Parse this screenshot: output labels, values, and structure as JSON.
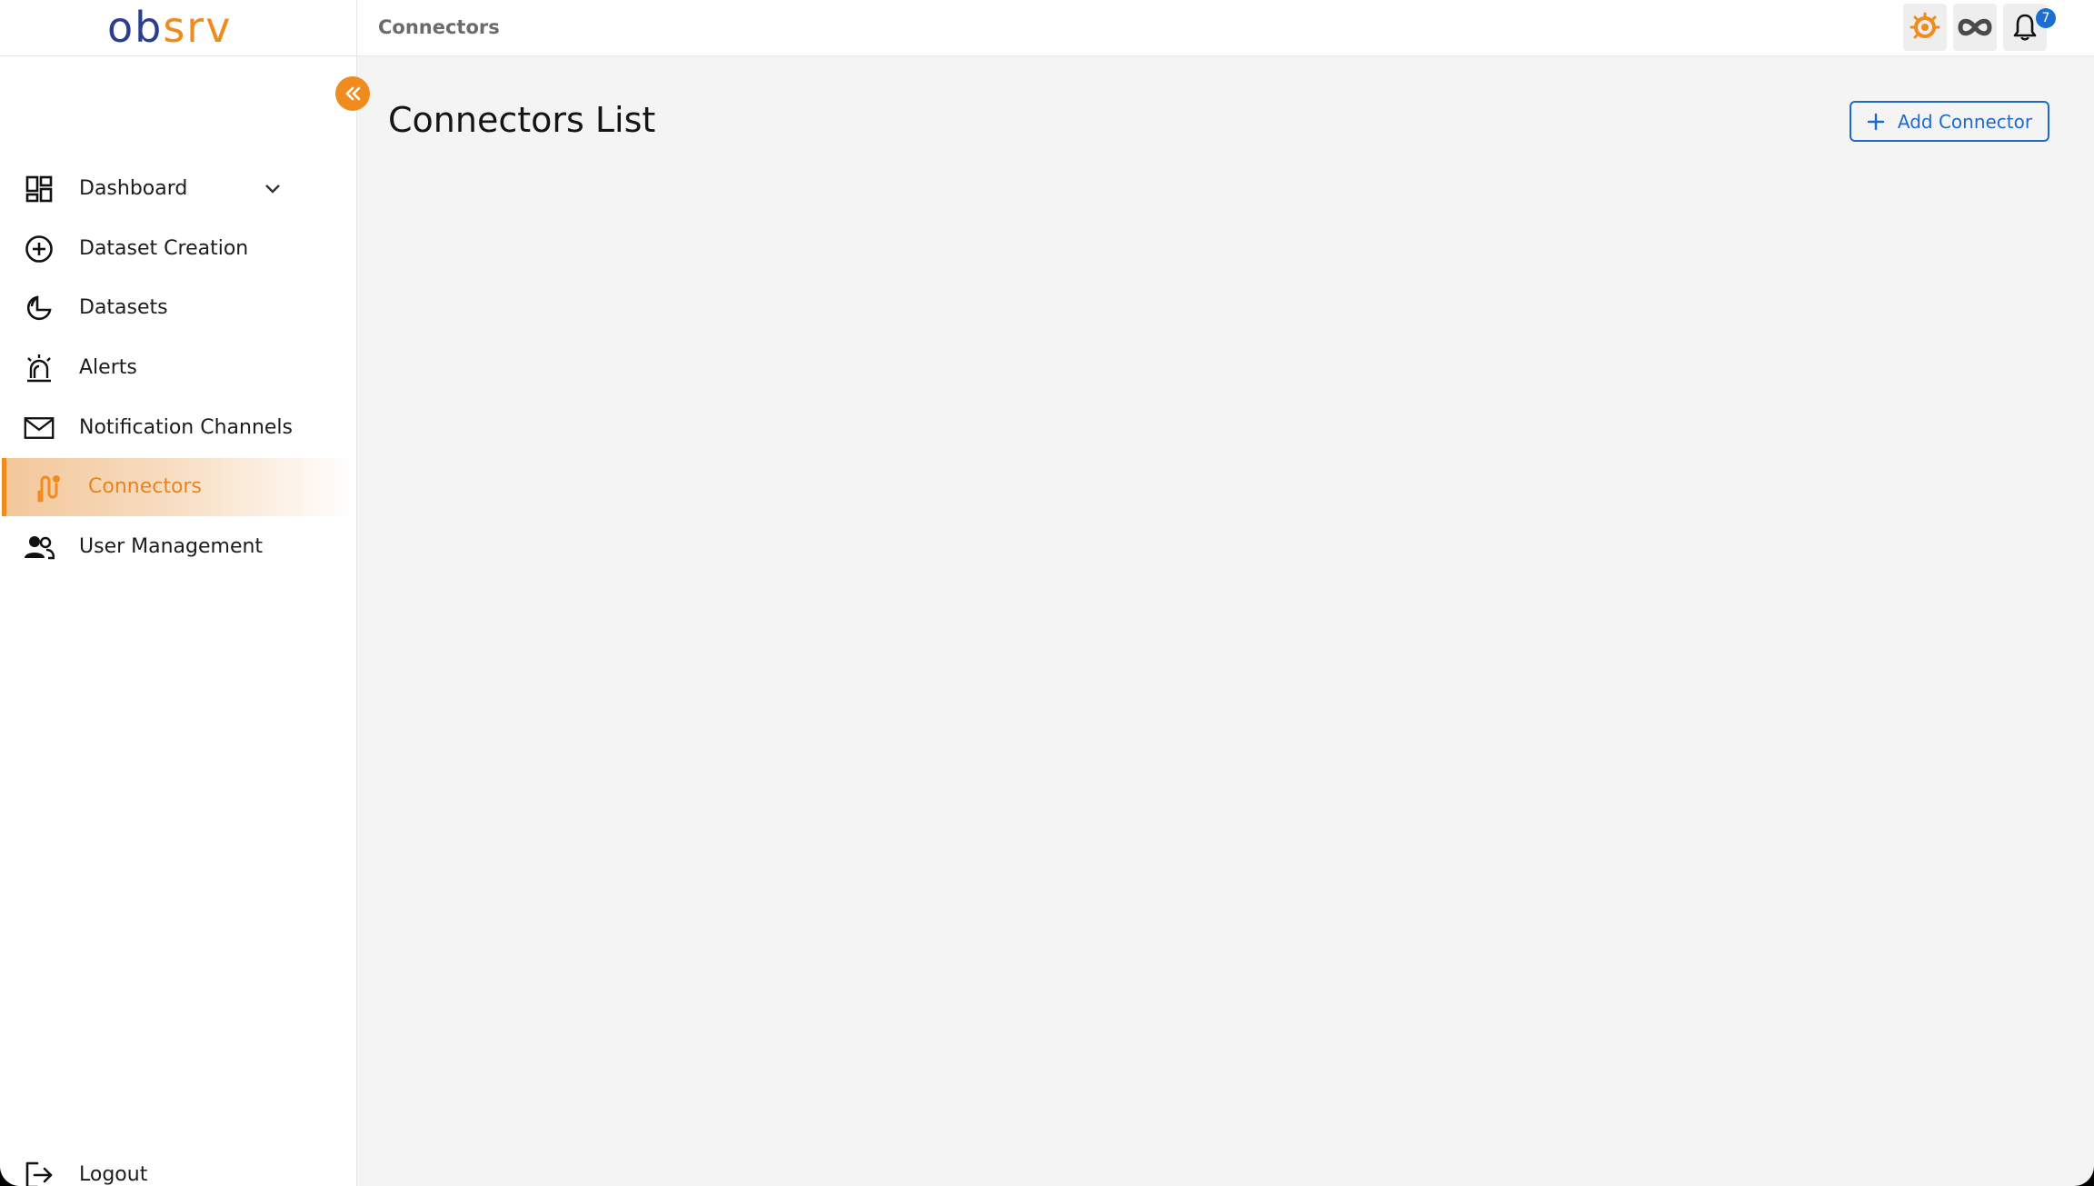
{
  "app": {
    "logo_part1": "ob",
    "logo_part2": "srv"
  },
  "header": {
    "breadcrumb": "Connectors",
    "notification_count": "7",
    "icons": [
      "grafana-icon",
      "infinity-icon",
      "bell-icon"
    ]
  },
  "sidebar": {
    "items": [
      {
        "label": "Dashboard",
        "icon": "dashboard-icon"
      },
      {
        "label": "Dataset Creation",
        "icon": "add-circle-icon"
      },
      {
        "label": "Datasets",
        "icon": "datasets-icon"
      },
      {
        "label": "Alerts",
        "icon": "alarm-icon"
      },
      {
        "label": "Notification Channels",
        "icon": "mail-icon"
      },
      {
        "label": "Connectors",
        "icon": "connectors-icon",
        "active": true
      },
      {
        "label": "User Management",
        "icon": "users-icon"
      }
    ],
    "logout": "Logout"
  },
  "main": {
    "title": "Connectors List",
    "add_button": "Add Connector"
  },
  "colors": {
    "accent": "#f08b1d",
    "brand_blue": "#2c3e8f",
    "link_blue": "#1f6ac9",
    "badge_blue": "#1a6fd1",
    "background": "#f4f4f4"
  }
}
